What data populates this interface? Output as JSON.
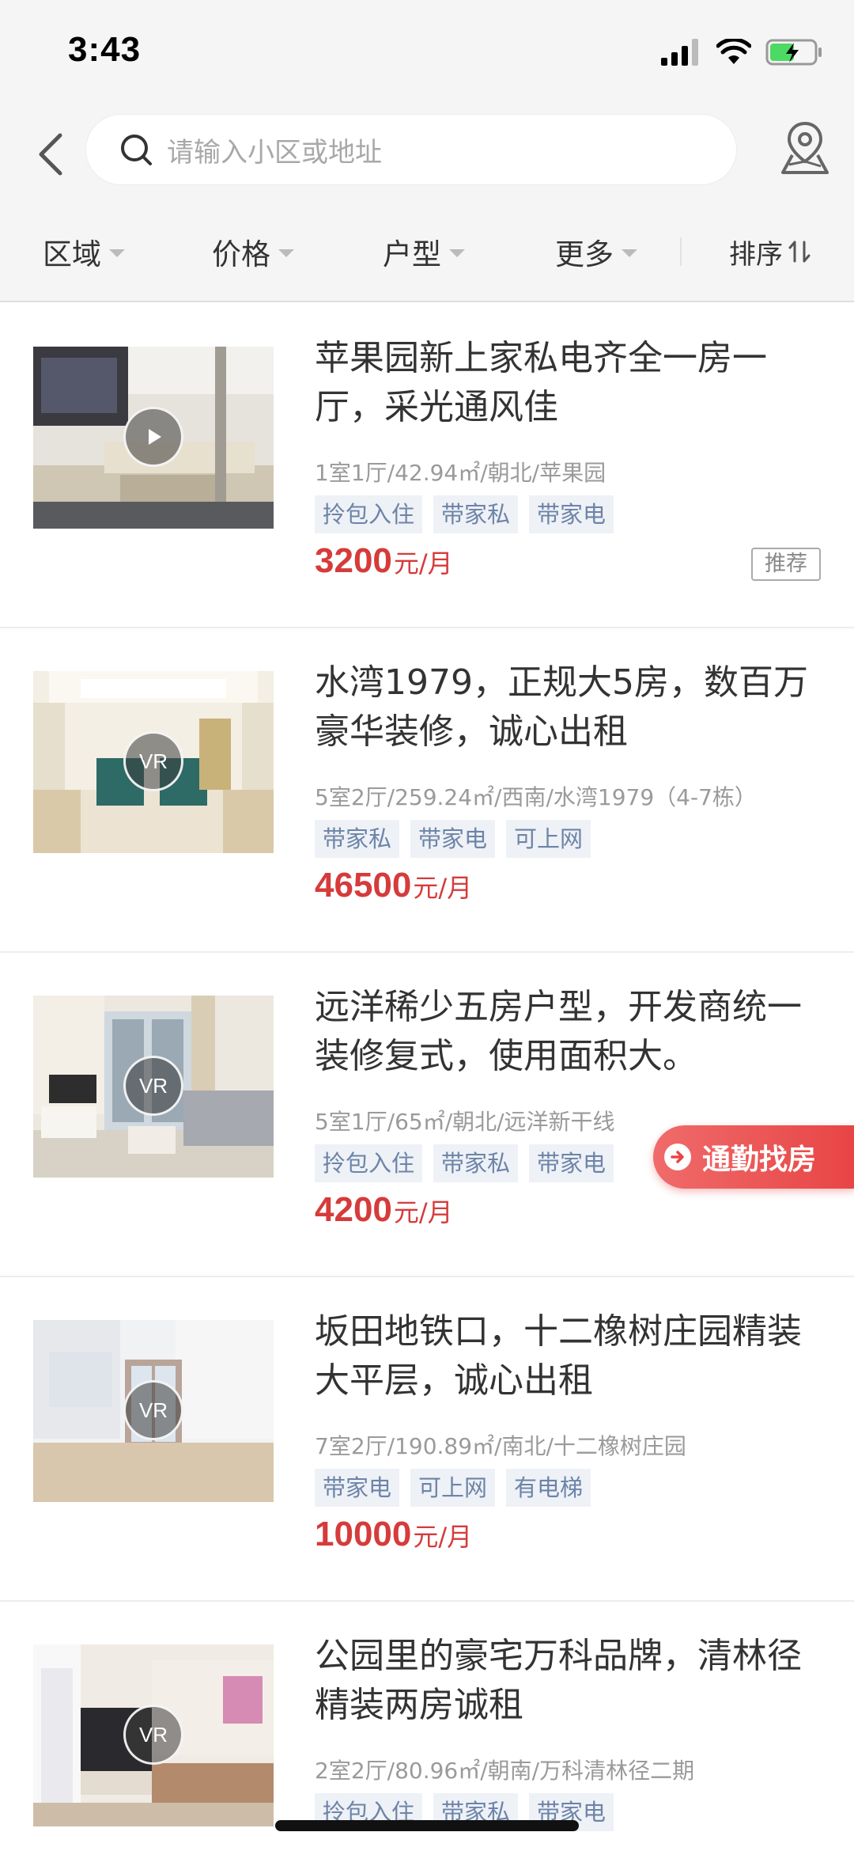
{
  "status_bar": {
    "time": "3:43"
  },
  "search": {
    "placeholder": "请输入小区或地址"
  },
  "filters": {
    "area": "区域",
    "price": "价格",
    "layout": "户型",
    "more": "更多",
    "sort": "排序"
  },
  "listings": [
    {
      "title": "苹果园新上家私电齐全一房一厅，采光通风佳",
      "meta": "1室1厅/42.94㎡/朝北/苹果园",
      "tags": [
        "拎包入住",
        "带家私",
        "带家电"
      ],
      "price": "3200",
      "price_unit": "元/月",
      "badge": "推荐",
      "media": "play-icon"
    },
    {
      "title": "水湾1979，正规大5房，数百万豪华装修，诚心出租",
      "meta": "5室2厅/259.24㎡/西南/水湾1979（4-7栋）",
      "tags": [
        "带家私",
        "带家电",
        "可上网"
      ],
      "price": "46500",
      "price_unit": "元/月",
      "media": "VR"
    },
    {
      "title": "远洋稀少五房户型，开发商统一装修复式，使用面积大。",
      "meta": "5室1厅/65㎡/朝北/远洋新干线",
      "tags": [
        "拎包入住",
        "带家私",
        "带家电"
      ],
      "price": "4200",
      "price_unit": "元/月",
      "media": "VR"
    },
    {
      "title": "坂田地铁口，十二橡树庄园精装大平层，诚心出租",
      "meta": "7室2厅/190.89㎡/南北/十二橡树庄园",
      "tags": [
        "带家电",
        "可上网",
        "有电梯"
      ],
      "price": "10000",
      "price_unit": "元/月",
      "media": "VR"
    },
    {
      "title": "公园里的豪宅万科品牌，清林径精装两房诚租",
      "meta": "2室2厅/80.96㎡/朝南/万科清林径二期",
      "tags": [
        "拎包入住",
        "带家私",
        "带家电"
      ],
      "media": "VR"
    }
  ],
  "commute": {
    "label": "通勤找房"
  }
}
